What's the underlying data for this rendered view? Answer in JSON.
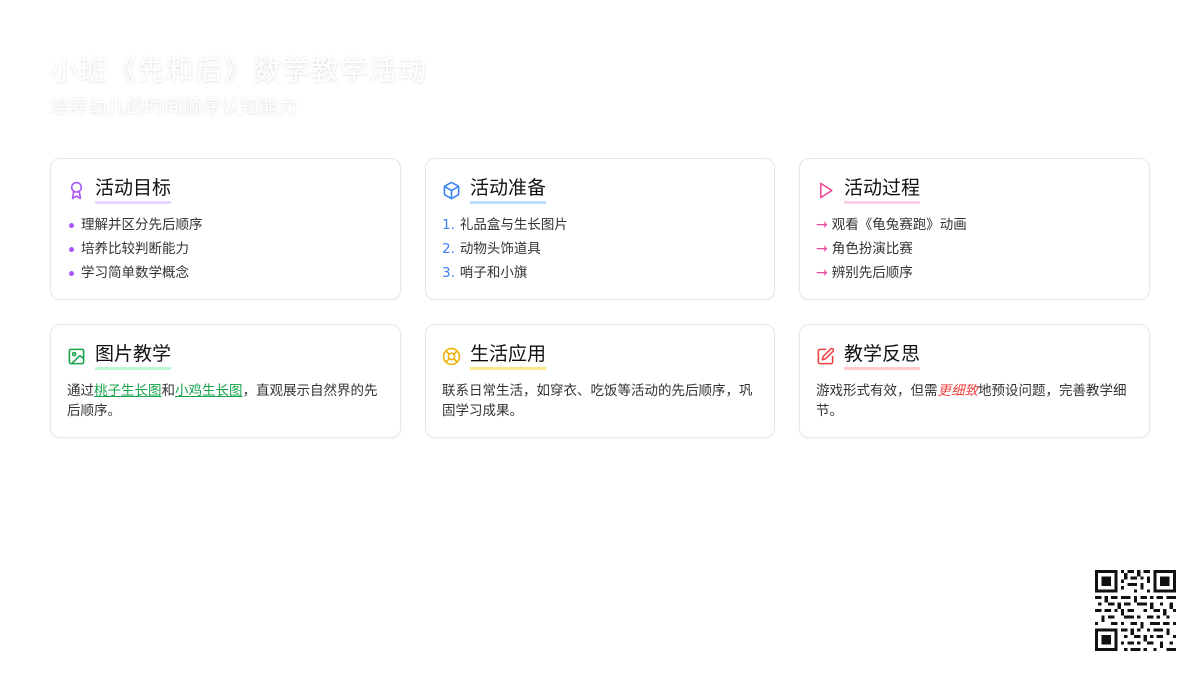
{
  "header": {
    "title": "小班《先和后》数学教学活动",
    "subtitle": "培养幼儿的时间顺序认知能力"
  },
  "cards": [
    {
      "title": "活动目标",
      "icon": "award-icon",
      "color": "#a855f7",
      "items": [
        "理解并区分先后顺序",
        "培养比较判断能力",
        "学习简单数学概念"
      ]
    },
    {
      "title": "活动准备",
      "icon": "box-icon",
      "color": "#3b82f6",
      "items": [
        {
          "num": "1.",
          "text": "礼品盒与生长图片"
        },
        {
          "num": "2.",
          "text": "动物头饰道具"
        },
        {
          "num": "3.",
          "text": "哨子和小旗"
        }
      ]
    },
    {
      "title": "活动过程",
      "icon": "play-icon",
      "color": "#ec4899",
      "items": [
        {
          "arrow": "→",
          "text": "观看《龟兔赛跑》动画"
        },
        {
          "arrow": "→",
          "text": "角色扮演比赛"
        },
        {
          "arrow": "→",
          "text": "辨别先后顺序"
        }
      ]
    },
    {
      "title": "图片教学",
      "icon": "image-icon",
      "color": "#16a34a",
      "p1": "通过",
      "link1": "桃子生长图",
      "p2": "和",
      "link2": "小鸡生长图",
      "p3": "，直观展示自然界的先后顺序。"
    },
    {
      "title": "生活应用",
      "icon": "lifebuoy-icon",
      "color": "#eab308",
      "text": "联系日常生活，如穿衣、吃饭等活动的先后顺序，巩固学习成果。"
    },
    {
      "title": "教学反思",
      "icon": "edit-icon",
      "color": "#ef4444",
      "p1": "游戏形式有效，但需",
      "emph": "更细致",
      "p2": "地预设问题，完善教学细节。"
    }
  ]
}
